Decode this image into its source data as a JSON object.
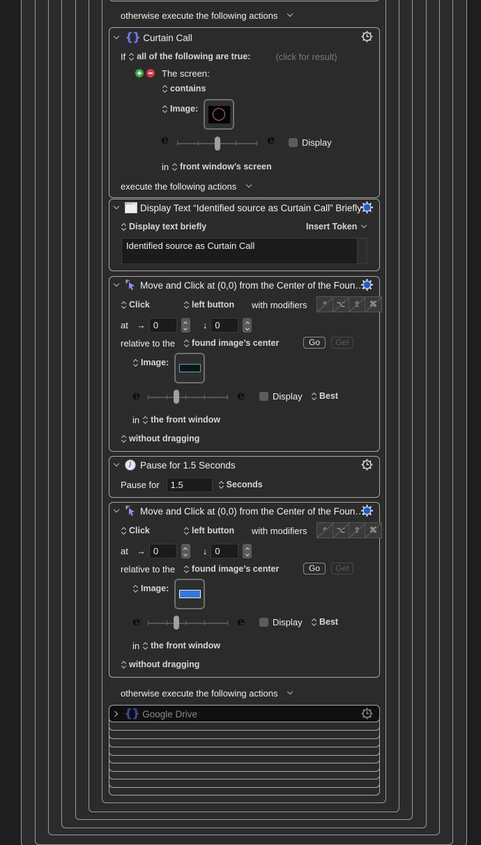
{
  "top_otherwise": "otherwise execute the following actions",
  "curtain_call": {
    "title": "Curtain Call",
    "if_label": "If",
    "condition": "all of the following are true:",
    "result_hint": "(click for result)",
    "screen_label": "The screen:",
    "contains": "contains",
    "image_label": "Image:",
    "display_label": "Display",
    "in_label": "in",
    "in_target": "front window’s screen",
    "execute": "execute the following actions",
    "fuzz_value": 0.5,
    "display_checked": false
  },
  "display_text": {
    "title": "Display Text “Identified source as Curtain Call” Briefly",
    "mode": "Display text briefly",
    "insert_token": "Insert Token",
    "text": "Identified source as Curtain Call"
  },
  "click1": {
    "title": "Move and Click at (0,0) from the Center of the Foun…",
    "click": "Click",
    "button": "left button",
    "with_modifiers": "with modifiers",
    "modifiers": [
      "^",
      "⌥",
      "⇧",
      "⌘"
    ],
    "at_label": "at",
    "x_arrow": "→",
    "x": "0",
    "y_arrow": "↓",
    "y": "0",
    "relative_label": "relative to the",
    "relative_target": "found image’s center",
    "go": "Go",
    "get": "Get",
    "image_label": "Image:",
    "display_label": "Display",
    "best": "Best",
    "in_label": "in",
    "in_target": "the front window",
    "drag": "without dragging",
    "fuzz_value": 0.3
  },
  "pause": {
    "title": "Pause for 1.5 Seconds",
    "label": "Pause for",
    "value": "1.5",
    "unit": "Seconds"
  },
  "click2": {
    "title": "Move and Click at (0,0) from the Center of the Foun…",
    "click": "Click",
    "button": "left button",
    "with_modifiers": "with modifiers",
    "modifiers": [
      "^",
      "⌥",
      "⇧",
      "⌘"
    ],
    "at_label": "at",
    "x_arrow": "→",
    "x": "0",
    "y_arrow": "↓",
    "y": "0",
    "relative_label": "relative to the",
    "relative_target": "found image’s center",
    "go": "Go",
    "get": "Get",
    "image_label": "Image:",
    "display_label": "Display",
    "best": "Best",
    "in_label": "in",
    "in_target": "the front window",
    "drag": "without dragging",
    "fuzz_value": 0.3
  },
  "bottom_otherwise": "otherwise execute the following actions",
  "google_drive": {
    "title": "Google Drive"
  },
  "colors": {
    "accent_blue": "#1a5fd6",
    "braces": "#6a7cf0",
    "add_green": "#3aa845",
    "remove_red": "#e0364c"
  }
}
